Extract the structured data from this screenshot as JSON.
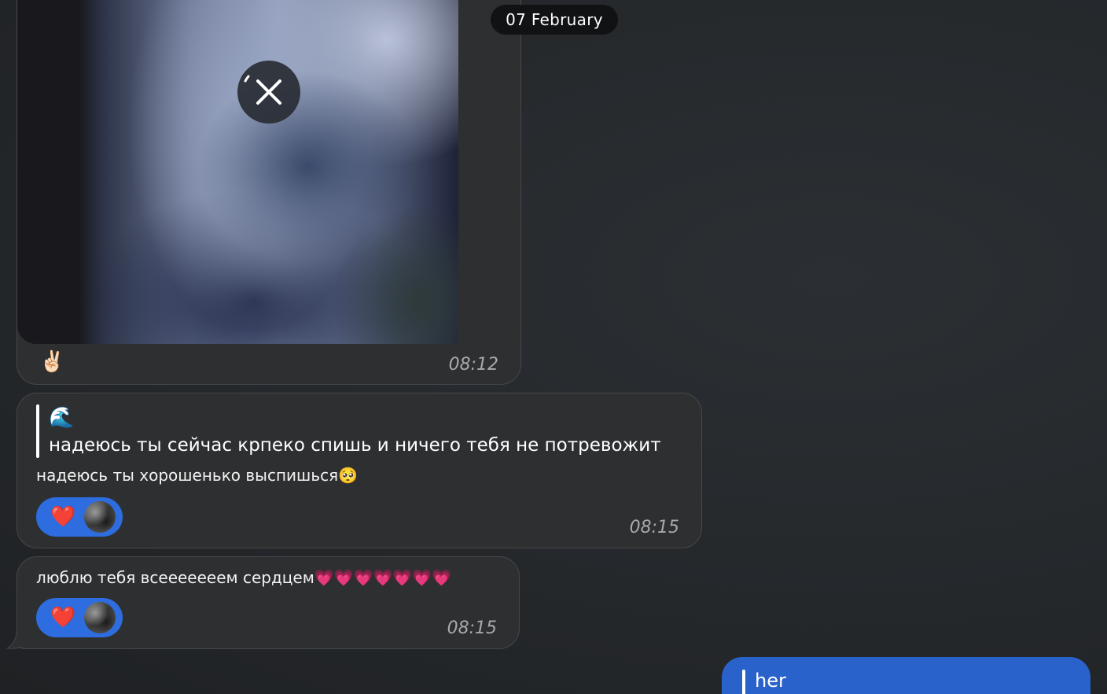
{
  "date_separator": "07 February",
  "messages": [
    {
      "kind": "photo",
      "caption_emoji": "✌🏻",
      "time": "08:12",
      "cancel_icon": "close-icon"
    },
    {
      "kind": "reply",
      "quote_emoji": "🌊",
      "quote_text": "надеюсь ты сейчас крпеко спишь и ничего тебя не потревожит",
      "text": "надеюсь ты хорошенько выспишься🥺",
      "reaction": "❤️",
      "time": "08:15"
    },
    {
      "kind": "text",
      "text": "люблю тебя всееееееем сердцем💗💗💗💗💗💗💗",
      "reaction": "❤️",
      "time": "08:15"
    },
    {
      "kind": "outgoing",
      "quote_text": "her"
    }
  ],
  "colors": {
    "incoming_bubble": "#2e2f31",
    "outgoing_bubble": "#2a62cc",
    "reaction_bg": "#2d6de0",
    "date_pill": "#111214"
  }
}
